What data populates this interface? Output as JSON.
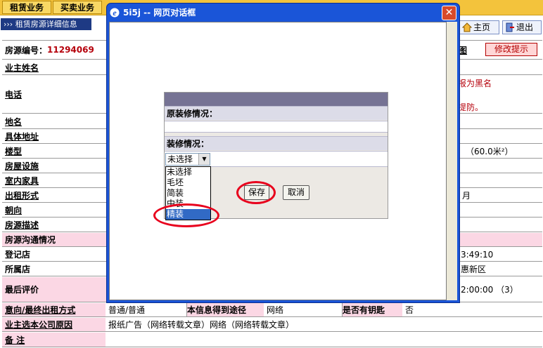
{
  "topnav": {
    "tab1": "租赁业务",
    "tab2": "买卖业务"
  },
  "breadcrumb": "››› 租赁房源详细信息",
  "header_buttons": {
    "home": "主页",
    "logout": "退出",
    "edit_hint": "修改提示"
  },
  "property": {
    "id_label": "房源编号：",
    "id_value": "11294069"
  },
  "rows": {
    "owner_name": "业主姓名",
    "phone": "电话",
    "place": "地名",
    "address": "具体地址",
    "floor": "楼型",
    "facilities": "房屋设施",
    "furniture": "室内家具",
    "rent_type": "出租形式",
    "orientation": "朝向",
    "description": "房源描述",
    "communication": "房源沟通情况",
    "register_store": "登记店",
    "owning_store": "所属店",
    "last_eval": "最后评价",
    "intent": "意向/最终出租方式",
    "reason": "业主选本公司原因",
    "remarks": "备 注"
  },
  "right_fragments": {
    "map": "图",
    "blacklist": "报为黑名",
    "prevent": "提防。",
    "area": "（60.0米²）",
    "month": "月",
    "time1": "3:49:10",
    "district": "惠新区",
    "time2": "2:00:00 （3）"
  },
  "intent_row": {
    "value": "普通/普通",
    "source_label": "本信息得到途径",
    "source_value": "网络",
    "key_label": "是否有钥匙",
    "key_value": "否"
  },
  "reason_value": "报纸广告（网络转载文章）网络（网络转载文章）",
  "dialog": {
    "title": "5i5j -- 网页对话框",
    "original_label": "原装修情况：",
    "decoration_label": "装修情况：",
    "selected": "未选择",
    "options": [
      "未选择",
      "毛坯",
      "简装",
      "中装",
      "精装"
    ],
    "save": "保存",
    "cancel": "取消"
  },
  "colors": {
    "highlight_ring": "#e8001c",
    "title_bar": "#1a55d8",
    "nav_bg": "#f3c33c"
  }
}
